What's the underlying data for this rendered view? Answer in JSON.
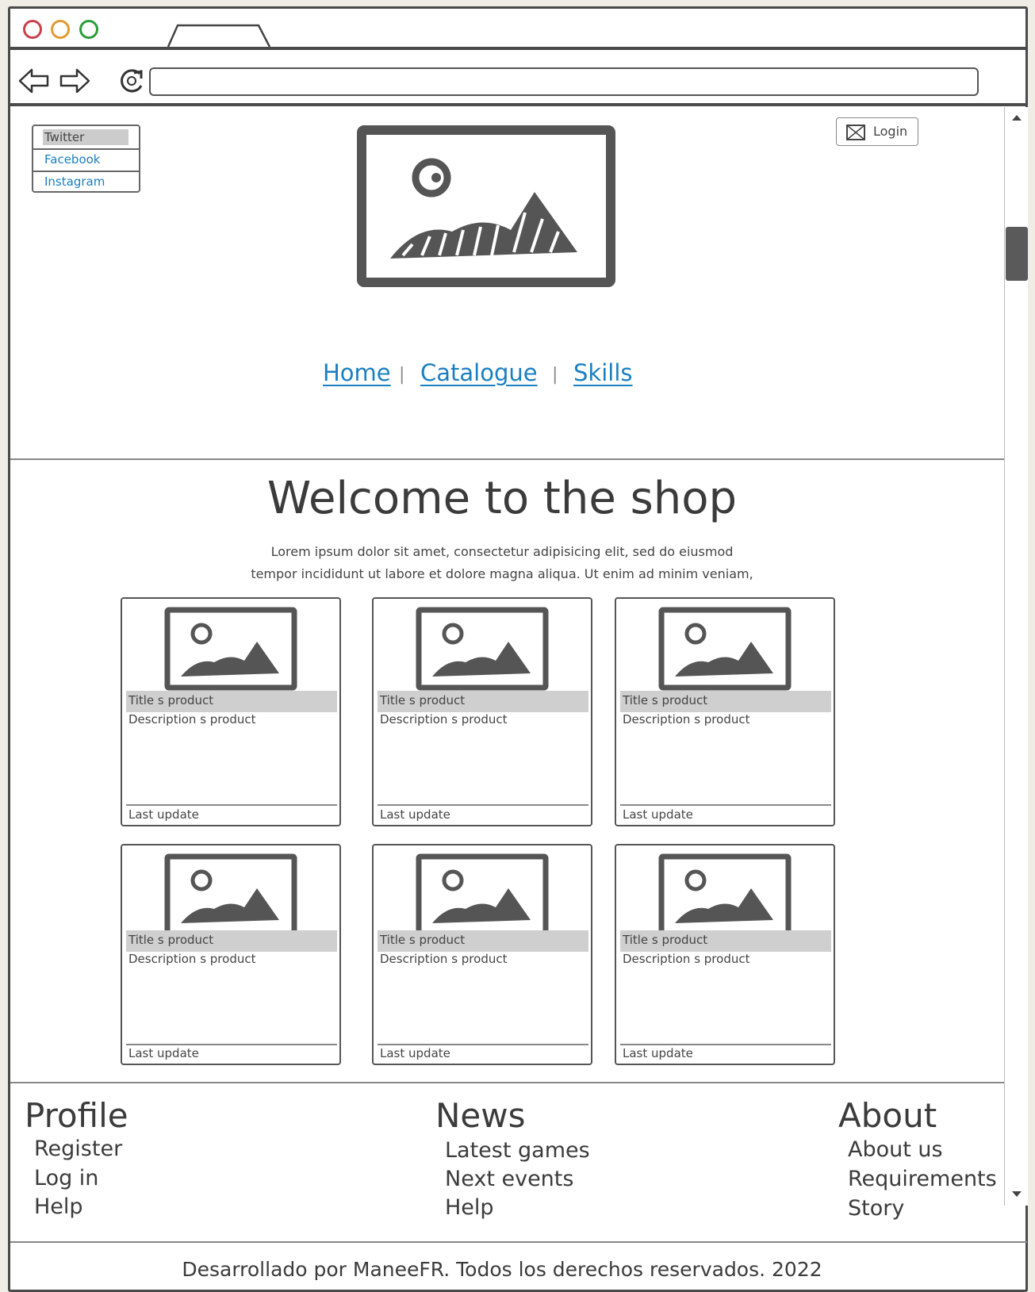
{
  "social": [
    "Twitter",
    "Facebook",
    "Instagram"
  ],
  "login_label": "Login",
  "nav": [
    "Home",
    "Catalogue",
    "Skills"
  ],
  "nav_separator": "|",
  "welcome": {
    "title": "Welcome to the shop",
    "lorem_line1": "Lorem ipsum dolor sit amet, consectetur adipisicing elit, sed do eiusmod",
    "lorem_line2": "tempor incididunt ut labore et dolore magna aliqua. Ut enim ad minim veniam,"
  },
  "products": [
    {
      "title": "Title s product",
      "description": "Description s  product",
      "updated": "Last update"
    },
    {
      "title": "Title s product",
      "description": "Description s  product",
      "updated": "Last update"
    },
    {
      "title": "Title s product",
      "description": "Description s  product",
      "updated": "Last update"
    },
    {
      "title": "Title s product",
      "description": "Description s  product",
      "updated": "Last update"
    },
    {
      "title": "Title s product",
      "description": "Description s  product",
      "updated": "Last update"
    },
    {
      "title": "Title s product",
      "description": "Description s  product",
      "updated": "Last update"
    }
  ],
  "footer": {
    "profile": {
      "heading": "Profile",
      "items": [
        "Register",
        "Log in",
        "Help"
      ]
    },
    "news": {
      "heading": "News",
      "items": [
        "Latest games",
        "Next events",
        "Help"
      ]
    },
    "about": {
      "heading": "About",
      "items": [
        "About us",
        "Requirements",
        "Story"
      ]
    },
    "copyright": "Desarrollado por ManeeFR. Todos los derechos reservados. 2022"
  },
  "icons": {
    "back": "back-arrow-icon",
    "forward": "forward-arrow-icon",
    "reload": "reload-icon",
    "mail": "mail-icon",
    "image": "image-placeholder-icon"
  },
  "colors": {
    "link": "#1a7fc2",
    "close_dot": "#c9404a",
    "minimize_dot": "#e39a32",
    "maximize_dot": "#2a9d3a"
  }
}
